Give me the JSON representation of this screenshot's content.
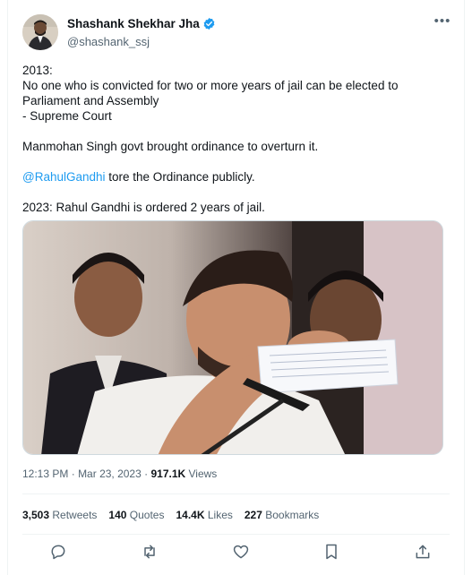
{
  "author": {
    "display_name": "Shashank Shekhar Jha",
    "handle": "@shashank_ssj",
    "verified": true
  },
  "tweet": {
    "lines": [
      "2013:",
      "No one who is convicted for two or more years of jail can be elected to Parliament and Assembly",
      "- Supreme Court",
      "Manmohan Singh govt brought ordinance to overturn it.",
      "tore the Ordinance publicly.",
      "2023: Rahul Gandhi is ordered 2 years of jail."
    ],
    "mention": "@RahulGandhi"
  },
  "meta": {
    "time": "12:13 PM",
    "separator": "·",
    "date": "Mar 23, 2023",
    "views_count": "917.1K",
    "views_label": "Views"
  },
  "stats": {
    "retweets": {
      "count": "3,503",
      "label": "Retweets"
    },
    "quotes": {
      "count": "140",
      "label": "Quotes"
    },
    "likes": {
      "count": "14.4K",
      "label": "Likes"
    },
    "bookmarks": {
      "count": "227",
      "label": "Bookmarks"
    }
  },
  "icons": {
    "reply": "reply-icon",
    "retweet": "retweet-icon",
    "like": "heart-icon",
    "bookmark": "bookmark-icon",
    "share": "share-icon",
    "verified": "verified-badge-icon",
    "more": "more-icon"
  },
  "colors": {
    "accent": "#1d9bf0",
    "text": "#0f1419",
    "secondary": "#536471",
    "border": "#eff3f4"
  }
}
